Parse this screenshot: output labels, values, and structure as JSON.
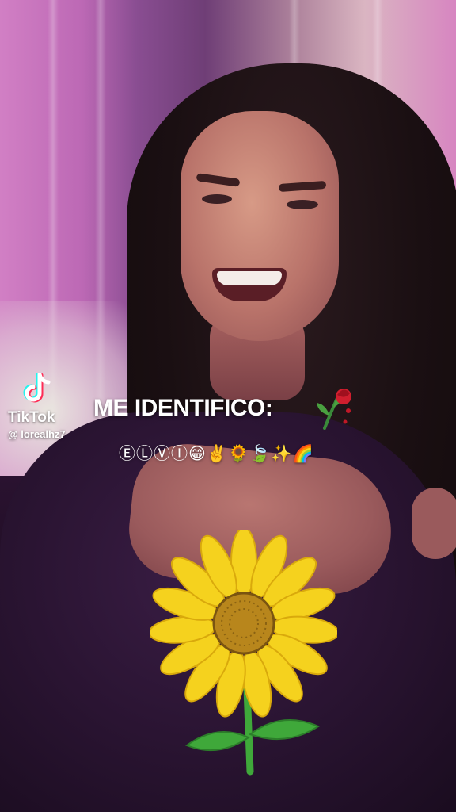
{
  "watermark": {
    "brand": "TikTok",
    "username": "@ lorealhz7",
    "icon": "tiktok-logo-icon"
  },
  "caption": {
    "title": "ME IDENTIFICO:",
    "title_emoji_icon": "wilted-rose-icon",
    "subtitle": "ⒺⓁⓋⒾ😁✌️🌻🍃✨🌈"
  },
  "sticker": {
    "icon": "sunflower-icon"
  },
  "colors": {
    "accent_cyan": "#25F4EE",
    "accent_red": "#FE2C55",
    "sunflower_petal": "#F5D21E",
    "sunflower_center": "#B8861C",
    "stem": "#3FA83A"
  }
}
